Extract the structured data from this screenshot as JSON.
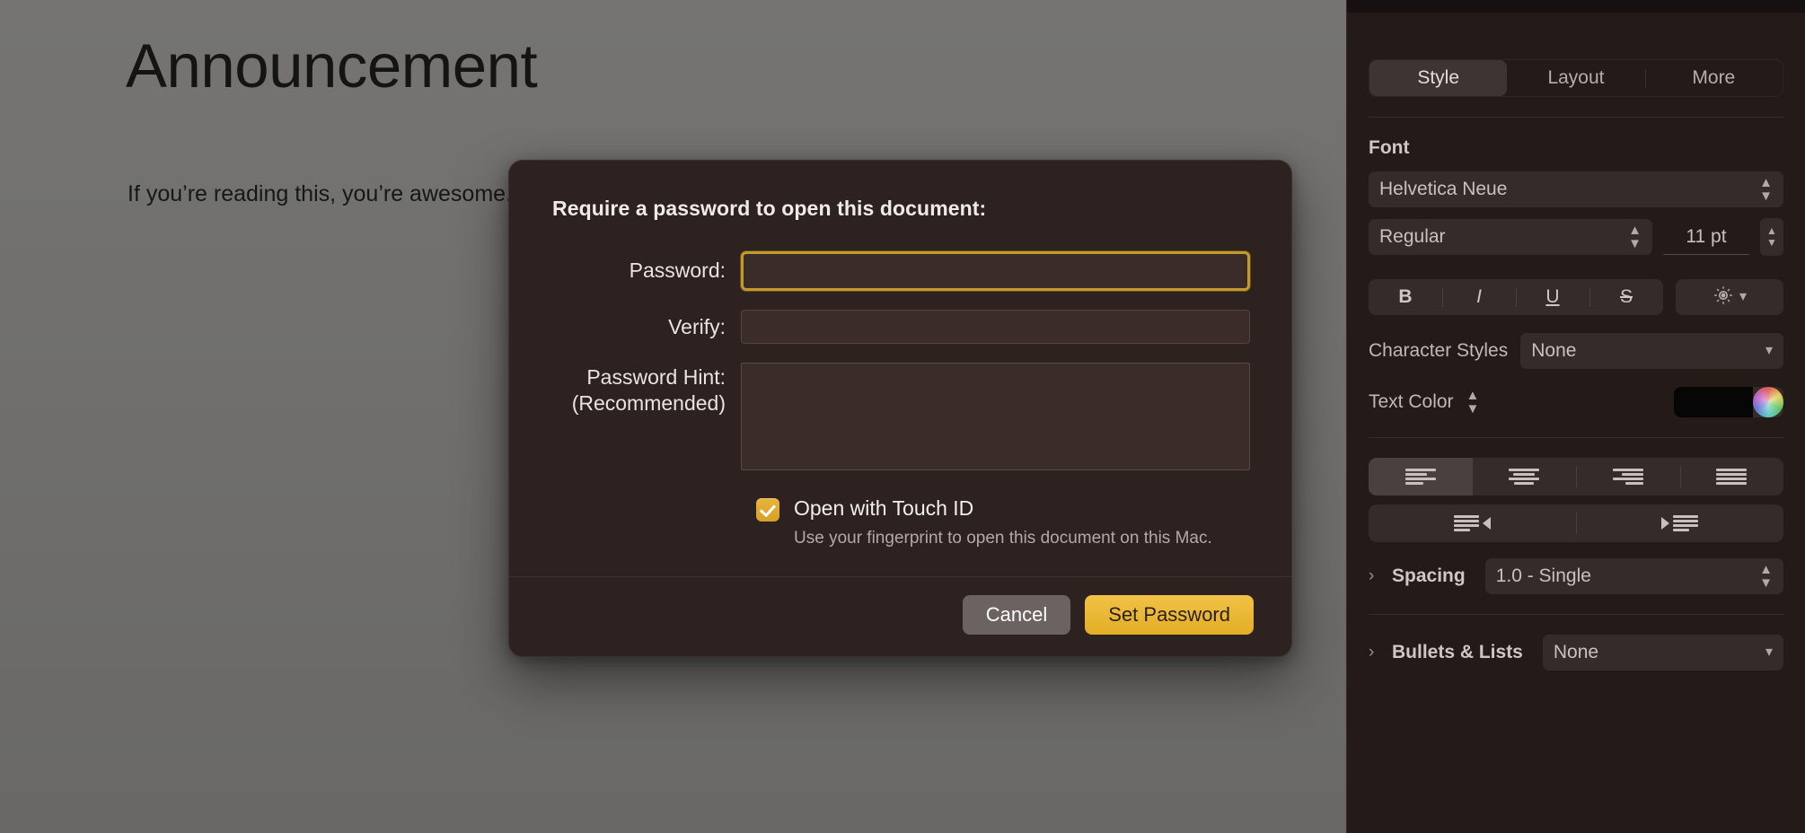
{
  "document": {
    "title": "Announcement",
    "body_text": "If you’re reading this, you’re awesome."
  },
  "dialog": {
    "heading": "Require a password to open this document:",
    "fields": {
      "password_label": "Password:",
      "password_value": "",
      "verify_label": "Verify:",
      "verify_value": "",
      "hint_label_line1": "Password Hint:",
      "hint_label_line2": "(Recommended)",
      "hint_value": ""
    },
    "touch_id": {
      "checkbox_label": "Open with Touch ID",
      "description": "Use your fingerprint to open this document on this Mac.",
      "checked": "true"
    },
    "buttons": {
      "cancel": "Cancel",
      "confirm": "Set Password"
    },
    "colors": {
      "background": "#2d2220",
      "accent": "#e3ae26",
      "focus_ring": "#c49a2c"
    }
  },
  "sidebar": {
    "tabs": [
      {
        "label": "Style",
        "active": "true"
      },
      {
        "label": "Layout",
        "active": "false"
      },
      {
        "label": "More",
        "active": "false"
      }
    ],
    "font": {
      "section_title": "Font",
      "family": "Helvetica Neue",
      "weight": "Regular",
      "size": "11 pt",
      "style_buttons": [
        {
          "name": "bold",
          "glyph": "B"
        },
        {
          "name": "italic",
          "glyph": "I"
        },
        {
          "name": "underline",
          "glyph": "U"
        },
        {
          "name": "strikethrough",
          "glyph": "S"
        }
      ],
      "gear_icon": "gear-icon"
    },
    "character_styles": {
      "label": "Character Styles",
      "value": "None"
    },
    "text_color": {
      "label": "Text Color",
      "swatch": "#060606"
    },
    "alignment": {
      "options": [
        {
          "name": "align-left",
          "active": "true"
        },
        {
          "name": "align-center",
          "active": "false"
        },
        {
          "name": "align-right",
          "active": "false"
        },
        {
          "name": "align-justify",
          "active": "false"
        }
      ],
      "indent": [
        {
          "name": "decrease-indent"
        },
        {
          "name": "increase-indent"
        }
      ]
    },
    "spacing": {
      "label": "Spacing",
      "value": "1.0 - Single",
      "disclosure": "›"
    },
    "bullets": {
      "label": "Bullets & Lists",
      "value": "None",
      "disclosure": "›"
    }
  }
}
